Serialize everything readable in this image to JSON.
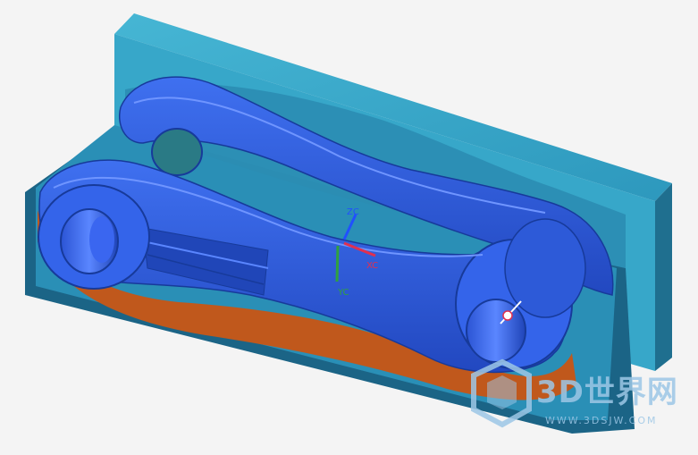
{
  "viewport": {
    "background": "#f4f4f4",
    "mold_light": "#3aa8c8",
    "mold_dark": "#1e6e8e",
    "part_blue": "#2f5ee6",
    "part_dark": "#1c3fa8",
    "parting_orange": "#c0581c"
  },
  "triad": {
    "zc": "ZC",
    "xc": "XC",
    "yc": "YC",
    "zc_color": "#2050ff",
    "xc_color": "#e03050",
    "yc_color": "#30a040"
  },
  "watermark": {
    "title": "3D世界网",
    "url": "WWW.3DSJW.COM",
    "color": "#9dc7e6"
  }
}
